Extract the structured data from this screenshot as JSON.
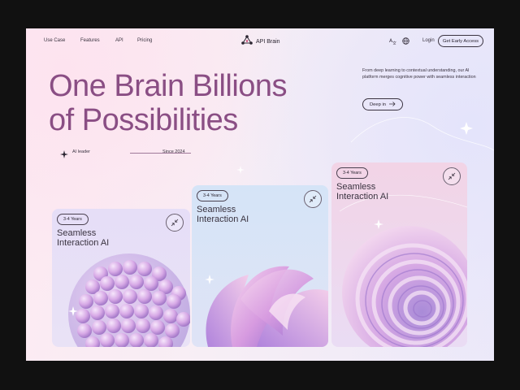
{
  "nav": {
    "links": [
      "Use Case",
      "Features",
      "API",
      "Pricing"
    ],
    "brand": "API Brain",
    "login": "Login",
    "cta": "Get Early Access",
    "icons": [
      "translate-icon",
      "globe-icon"
    ]
  },
  "hero": {
    "title_line1": "One Brain Billions",
    "title_line2": "of Possibilities",
    "meta_left": "AI leader",
    "meta_right": "Since 2024",
    "description": "From deep learning to contextual understanding, our AI platform merges cognitive power with seamless interaction",
    "button": "Deep in"
  },
  "cards": [
    {
      "badge": "3-4 Years",
      "title": "Seamless Interaction AI"
    },
    {
      "badge": "3-4 Years",
      "title": "Seamless Interaction AI"
    },
    {
      "badge": "3-4 Years",
      "title": "Seamless Interaction AI"
    }
  ],
  "colors": {
    "title": "#8a4e84",
    "text": "#3a3340",
    "card1": "#e6def7",
    "card2": "#d5e4f7",
    "card3": "#f2d4e6"
  }
}
